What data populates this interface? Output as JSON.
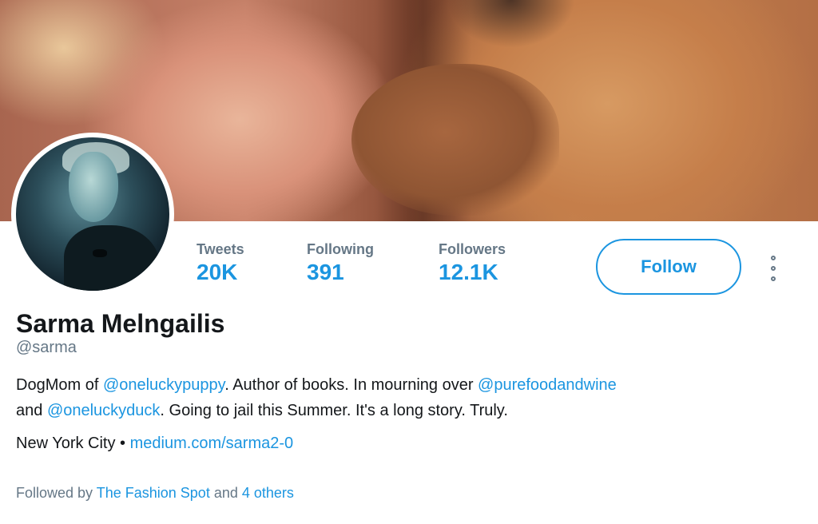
{
  "profile": {
    "name": "Sarma Melngailis",
    "handle": "@sarma",
    "bio": {
      "part1": "DogMom of ",
      "mention1": "@oneluckypuppy",
      "part2": ". Author of books. In mourning over ",
      "mention2": "@purefoodandwine",
      "part3": "and ",
      "mention3": "@oneluckyduck",
      "part4": ". Going to jail this Summer. It's a long story. Truly."
    },
    "location": "New York City",
    "separator": " • ",
    "website": "medium.com/sarma2-0"
  },
  "stats": [
    {
      "label": "Tweets",
      "value": "20K"
    },
    {
      "label": "Following",
      "value": "391"
    },
    {
      "label": "Followers",
      "value": "12.1K"
    }
  ],
  "actions": {
    "follow_label": "Follow",
    "more_icon": "more-vertical-icon"
  },
  "followed_by": {
    "prefix": "Followed by ",
    "account": "The Fashion Spot",
    "middle": " and ",
    "others": "4 others"
  },
  "colors": {
    "accent": "#1b95e0",
    "secondary_text": "#657786",
    "primary_text": "#14171a"
  }
}
